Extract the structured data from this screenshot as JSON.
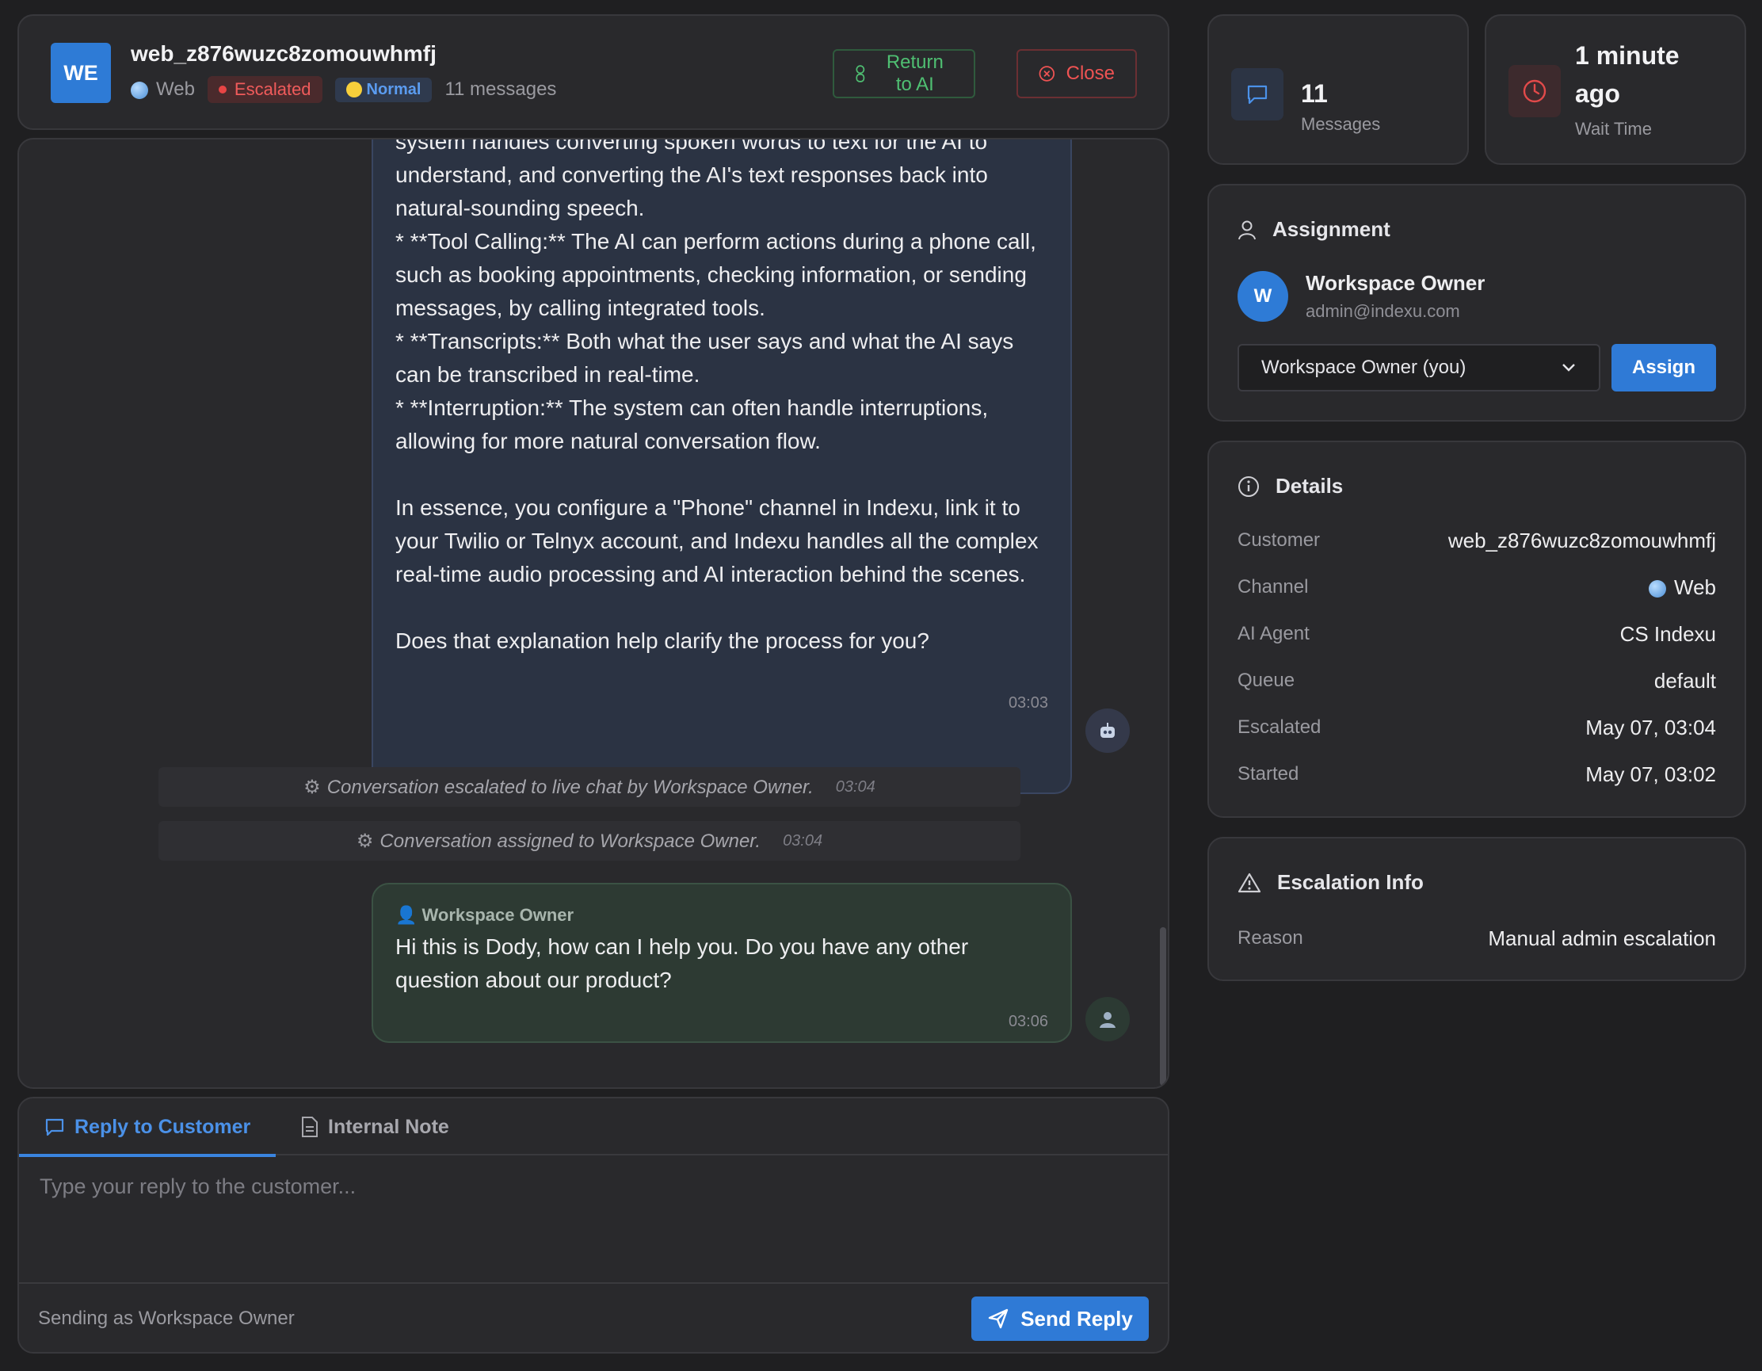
{
  "header": {
    "avatar_initials": "WE",
    "customer_id": "web_z876wuzc8zomouwhmfj",
    "channel": "Web",
    "status_badge": "Escalated",
    "priority_badge": "Normal",
    "message_count": "11 messages",
    "return_label": "Return to AI",
    "close_label": "Close"
  },
  "chat": {
    "ai_message": {
      "text": "system handles converting spoken words to text for the AI to understand, and converting the AI's text responses back into natural-sounding speech.\n* **Tool Calling:** The AI can perform actions during a phone call, such as booking appointments, checking information, or sending messages, by calling integrated tools.\n* **Transcripts:** Both what the user says and what the AI says can be transcribed in real-time.\n* **Interruption:** The system can often handle interruptions, allowing for more natural conversation flow.\n\nIn essence, you configure a \"Phone\" channel in Indexu, link it to your Twilio or Telnyx account, and Indexu handles all the complex real-time audio processing and AI interaction behind the scenes.\n\nDoes that explanation help clarify the process for you?",
      "time": "03:03"
    },
    "system_events": [
      {
        "text": "Conversation escalated to live chat by Workspace Owner.",
        "time": "03:04"
      },
      {
        "text": "Conversation assigned to Workspace Owner.",
        "time": "03:04"
      }
    ],
    "human_message": {
      "sender": "Workspace Owner",
      "text": "Hi this is Dody, how can I help you. Do you have any other question about our product?",
      "time": "03:06"
    }
  },
  "composer": {
    "tab_reply": "Reply to Customer",
    "tab_note": "Internal Note",
    "placeholder": "Type your reply to the customer...",
    "sending_as": "Sending as Workspace Owner",
    "send_label": "Send Reply"
  },
  "stats": {
    "messages_value": "11",
    "messages_label": "Messages",
    "wait_value": "1 minute ago",
    "wait_label": "Wait Time"
  },
  "assignment": {
    "title": "Assignment",
    "avatar_initial": "W",
    "owner_name": "Workspace Owner",
    "owner_email": "admin@indexu.com",
    "select_value": "Workspace Owner (you)",
    "assign_label": "Assign"
  },
  "details": {
    "title": "Details",
    "rows": [
      {
        "key": "Customer",
        "value": "web_z876wuzc8zomouwhmfj"
      },
      {
        "key": "Channel",
        "value": "Web"
      },
      {
        "key": "AI Agent",
        "value": "CS Indexu"
      },
      {
        "key": "Queue",
        "value": "default"
      },
      {
        "key": "Escalated",
        "value": "May 07, 03:04"
      },
      {
        "key": "Started",
        "value": "May 07, 03:02"
      }
    ]
  },
  "escalation": {
    "title": "Escalation Info",
    "reason_key": "Reason",
    "reason_value": "Manual admin escalation"
  },
  "colors": {
    "accent": "#2f7ad6",
    "escalated": "#f05b5b",
    "return_green": "#4fbf72"
  }
}
